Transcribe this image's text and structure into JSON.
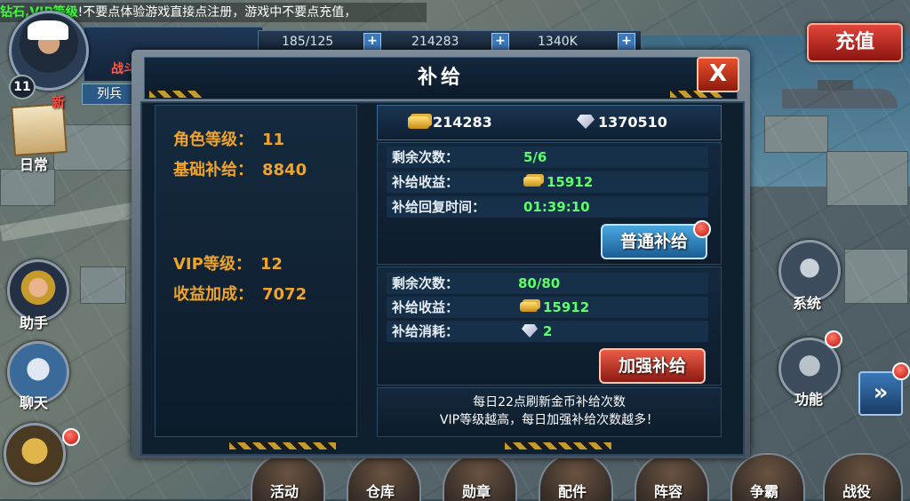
{
  "notice": {
    "prefix": "钻石,VIP等级",
    "text": "!不要点体验游戏直接点注册，游戏中不要点充值，"
  },
  "player": {
    "level": "11",
    "name_fragment": "战斗",
    "rank_label": "列兵"
  },
  "resources_top": {
    "item1": "185/125",
    "item2": "214283",
    "item3": "1340K"
  },
  "recharge_label": "充值",
  "side_menu": {
    "daily": "日常",
    "new_badge": "新",
    "assistant": "助手",
    "chat": "聊天",
    "system": "系统",
    "function": "功能"
  },
  "bottom_menu": [
    "活动",
    "仓库",
    "勋章",
    "配件",
    "阵容",
    "争霸",
    "战役"
  ],
  "dialog": {
    "title": "补给",
    "close": "X",
    "stats": {
      "role_level_label": "角色等级：",
      "role_level": "11",
      "base_supply_label": "基础补给：",
      "base_supply": "8840",
      "vip_level_label": "VIP等级：",
      "vip_level": "12",
      "bonus_label": "收益加成：",
      "bonus": "7072"
    },
    "gold": "214283",
    "gems": "1370510",
    "normal": {
      "remaining_label": "剩余次数：",
      "remaining": "5/6",
      "income_label": "补给收益：",
      "income": "15912",
      "recover_label": "补给回复时间：",
      "recover_time": "01:39:10",
      "button": "普通补给"
    },
    "enhanced": {
      "remaining_label": "剩余次数：",
      "remaining": "80/80",
      "income_label": "补给收益：",
      "income": "15912",
      "cost_label": "补给消耗：",
      "cost": "2",
      "button": "加强补给"
    },
    "footer_line1": "每日22点刷新金币补给次数",
    "footer_line2": "VIP等级越高，每日加强补给次数越多！"
  },
  "colors": {
    "stat_orange": "#f0a42a",
    "value_green": "#5cff6a",
    "accent_red": "#c0120c"
  }
}
